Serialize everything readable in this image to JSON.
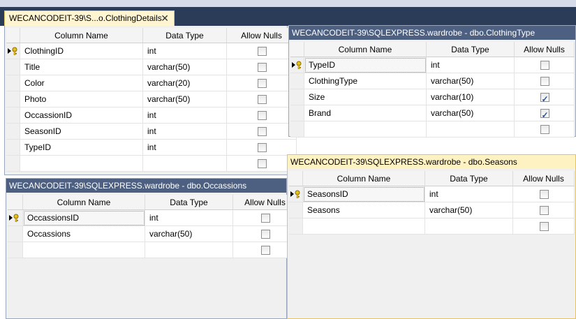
{
  "tab": {
    "title": "WECANCODEIT-39\\S...o.ClothingDetails",
    "close": "✕"
  },
  "headers": {
    "col1": "Column Name",
    "col2": "Data Type",
    "col3": "Allow Nulls"
  },
  "tables": [
    {
      "title": "",
      "rows": [
        {
          "name": "ClothingID",
          "type": "int",
          "nulls": false,
          "key": true
        },
        {
          "name": "Title",
          "type": "varchar(50)",
          "nulls": false
        },
        {
          "name": "Color",
          "type": "varchar(20)",
          "nulls": false
        },
        {
          "name": "Photo",
          "type": "varchar(50)",
          "nulls": false
        },
        {
          "name": "OccassionID",
          "type": "int",
          "nulls": false
        },
        {
          "name": "SeasonID",
          "type": "int",
          "nulls": false
        },
        {
          "name": "TypeID",
          "type": "int",
          "nulls": false
        },
        {
          "name": "",
          "type": "",
          "nulls": false
        }
      ]
    },
    {
      "title": "WECANCODEIT-39\\SQLEXPRESS.wardrobe - dbo.ClothingType",
      "rows": [
        {
          "name": "TypeID",
          "type": "int",
          "nulls": false,
          "key": true
        },
        {
          "name": "ClothingType",
          "type": "varchar(50)",
          "nulls": false
        },
        {
          "name": "Size",
          "type": "varchar(10)",
          "nulls": true
        },
        {
          "name": "Brand",
          "type": "varchar(50)",
          "nulls": true
        },
        {
          "name": "",
          "type": "",
          "nulls": false
        }
      ]
    },
    {
      "title": "WECANCODEIT-39\\SQLEXPRESS.wardrobe - dbo.Occassions",
      "rows": [
        {
          "name": "OccassionsID",
          "type": "int",
          "nulls": false,
          "key": true
        },
        {
          "name": "Occassions",
          "type": "varchar(50)",
          "nulls": false
        },
        {
          "name": "",
          "type": "",
          "nulls": false
        }
      ]
    },
    {
      "title": "WECANCODEIT-39\\SQLEXPRESS.wardrobe - dbo.Seasons",
      "rows": [
        {
          "name": "SeasonsID",
          "type": "int",
          "nulls": false,
          "key": true
        },
        {
          "name": "Seasons",
          "type": "varchar(50)",
          "nulls": false
        },
        {
          "name": "",
          "type": "",
          "nulls": false
        }
      ]
    }
  ]
}
